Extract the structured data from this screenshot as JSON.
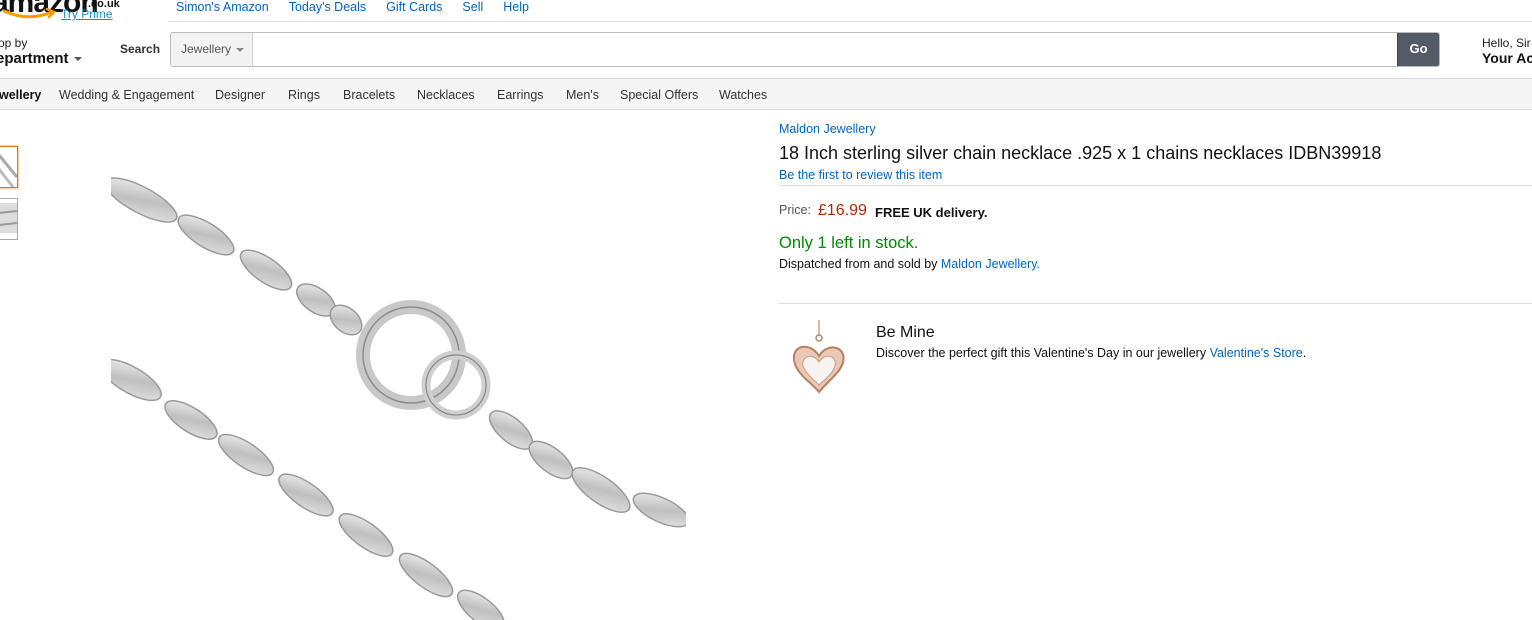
{
  "header": {
    "logo_text": "amazon",
    "logo_tld": ".co.uk",
    "try_prime": "Try Prime",
    "top_links": [
      "Simon's Amazon",
      "Today's Deals",
      "Gift Cards",
      "Sell",
      "Help"
    ],
    "shop_by_small": "op by",
    "shop_by_big": "epartment",
    "search_label": "Search",
    "search_category": "Jewellery",
    "search_placeholder": "",
    "go_label": "Go",
    "greeting": "Hello, Sir",
    "account_label": "Your Ac"
  },
  "category_nav": {
    "items": [
      "wellery",
      "Wedding & Engagement",
      "Designer",
      "Rings",
      "Bracelets",
      "Necklaces",
      "Earrings",
      "Men's",
      "Special Offers",
      "Watches"
    ]
  },
  "product": {
    "brand": "Maldon Jewellery",
    "title": "18 Inch sterling silver chain necklace .925 x 1 chains necklaces IDBN39918",
    "review_link": "Be the first to review this item",
    "price_label": "Price:",
    "price": "£16.99",
    "delivery": "FREE UK delivery.",
    "stock": "Only 1 left in stock.",
    "dispatch_prefix": "Dispatched from and sold by ",
    "seller": "Maldon Jewellery",
    "dispatch_suffix": "."
  },
  "promo": {
    "title": "Be Mine",
    "text_prefix": "Discover the perfect gift this Valentine's Day in our jewellery ",
    "link": "Valentine's Store",
    "text_suffix": "."
  },
  "colors": {
    "link": "#0066c0",
    "price": "#b12704",
    "stock": "#008a00",
    "go_button": "#525b66",
    "logo_smile": "#f90"
  }
}
